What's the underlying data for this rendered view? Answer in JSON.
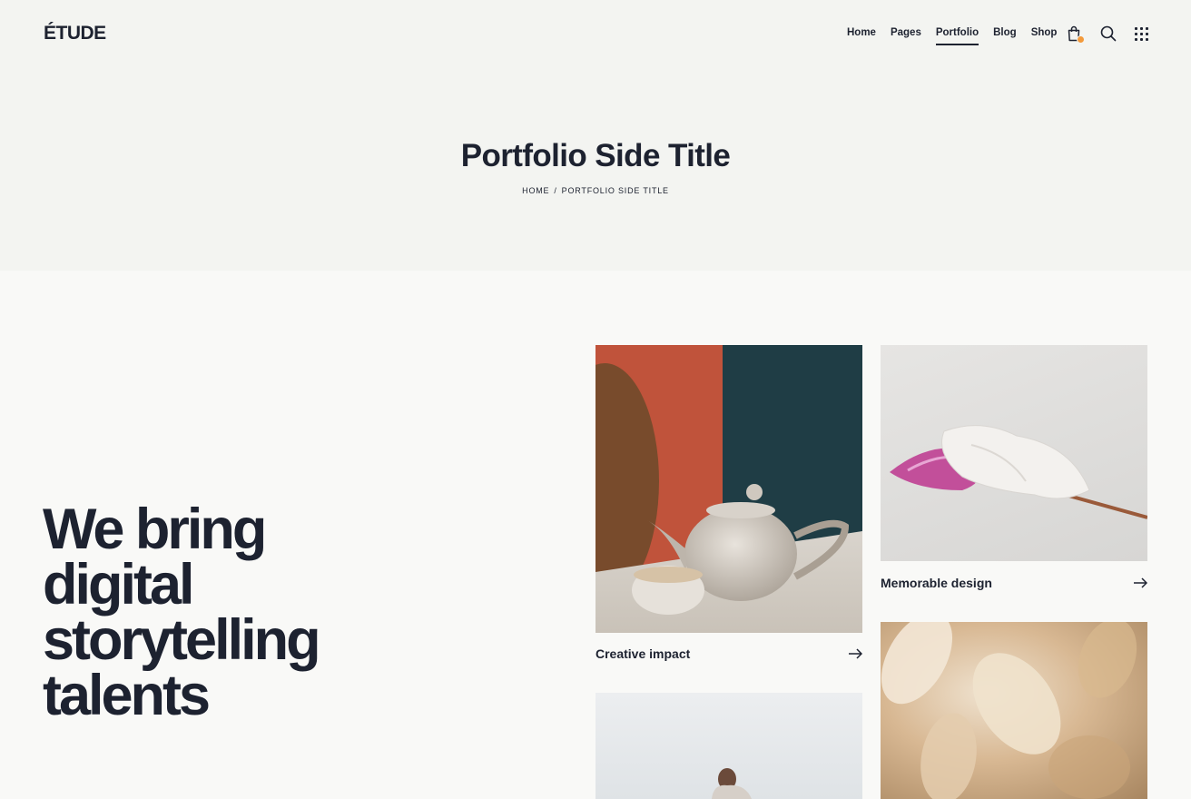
{
  "header": {
    "logo": "ÉTUDE",
    "nav": [
      "Home",
      "Pages",
      "Portfolio",
      "Blog",
      "Shop"
    ],
    "active_nav": "Portfolio",
    "icons": [
      "shopping-bag-icon",
      "search-icon",
      "grid-menu-icon"
    ],
    "accent_color": "#f39a3b"
  },
  "hero": {
    "title": "Portfolio Side Title",
    "breadcrumb": {
      "home": "HOME",
      "separator": "/",
      "current": "PORTFOLIO SIDE TITLE"
    }
  },
  "main": {
    "tagline": "We bring digital storytelling talents",
    "portfolio": [
      {
        "title": "Creative impact",
        "image": "teapot-photo"
      },
      {
        "title": "Memorable design",
        "image": "pink-flower-photo"
      },
      {
        "title": "",
        "image": "woman-outdoors-photo"
      },
      {
        "title": "",
        "image": "dried-grass-photo"
      }
    ]
  },
  "colors": {
    "text": "#1d2230",
    "hero_bg": "#f3f4f1",
    "page_bg": "#f9f9f7"
  }
}
